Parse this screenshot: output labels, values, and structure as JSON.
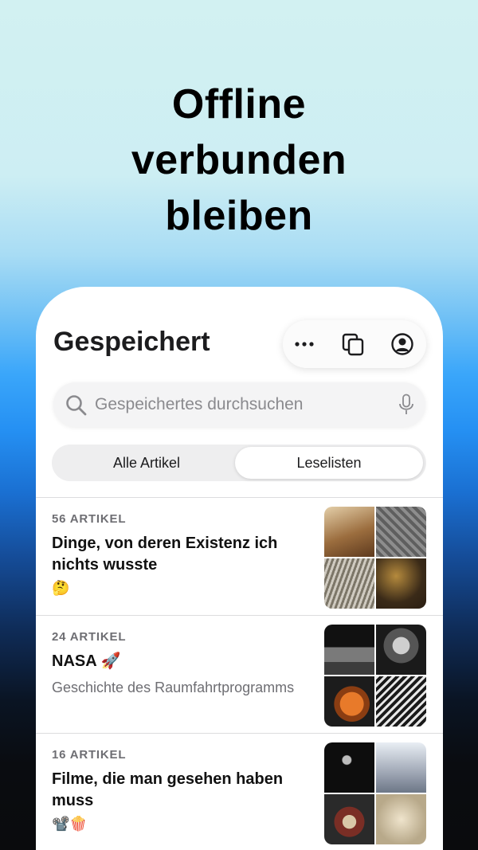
{
  "headline": [
    "Offline",
    "verbunden",
    "bleiben"
  ],
  "screen": {
    "title": "Gespeichert",
    "actions": [
      "more-options",
      "tabs",
      "account"
    ],
    "search": {
      "placeholder": "Gespeichertes durchsuchen"
    },
    "segments": [
      "Alle Artikel",
      "Leselisten"
    ],
    "active_segment": "Leselisten",
    "lists": [
      {
        "count": "56 ARTIKEL",
        "title": "Dinge, von deren Existenz ich nichts wusste",
        "subtitle": "",
        "emoji": "🤔"
      },
      {
        "count": "24 ARTIKEL",
        "title": "NASA 🚀",
        "subtitle": "Geschichte des Raumfahrtprogramms",
        "emoji": ""
      },
      {
        "count": "16 ARTIKEL",
        "title": "Filme, die man gesehen haben muss",
        "subtitle": "",
        "emoji": "📽️🍿"
      }
    ]
  },
  "colors": {
    "accent_bg_top": "#d2f1f2",
    "accent_blue": "#2590f3",
    "text": "#1c1c1e",
    "secondary": "#6e6e73"
  }
}
